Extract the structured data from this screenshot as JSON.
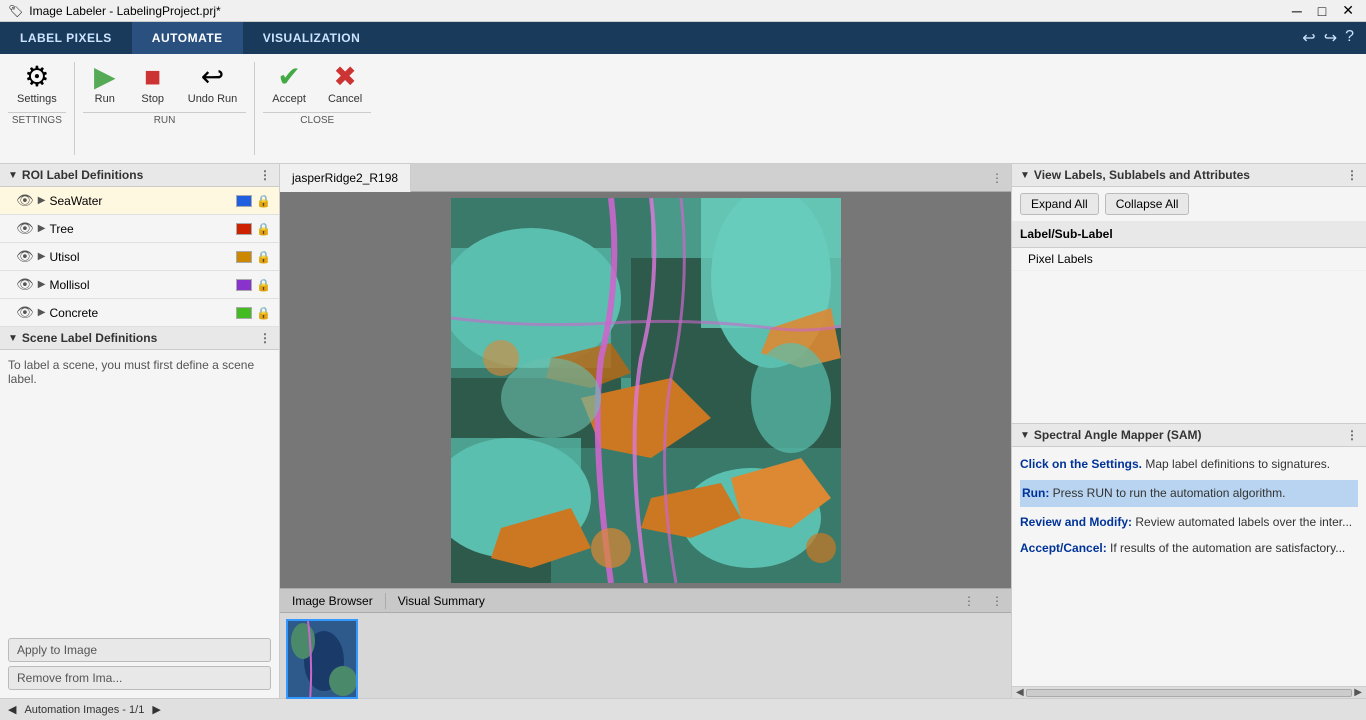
{
  "window": {
    "title": "Image Labeler - LabelingProject.prj*",
    "icon": "🏷"
  },
  "tabs": {
    "items": [
      {
        "label": "LABEL PIXELS",
        "active": false
      },
      {
        "label": "AUTOMATE",
        "active": true
      },
      {
        "label": "VISUALIZATION",
        "active": false
      }
    ]
  },
  "toolbar": {
    "settings_label": "Settings",
    "run_label": "Run",
    "stop_label": "Stop",
    "undo_run_label": "Undo Run",
    "accept_label": "Accept",
    "cancel_label": "Cancel",
    "groups": {
      "settings": "SETTINGS",
      "run": "RUN",
      "close": "CLOSE"
    }
  },
  "left_panel": {
    "roi_header": "ROI Label Definitions",
    "roi_items": [
      {
        "label": "SeaWater",
        "color": "#2060e0",
        "selected": true
      },
      {
        "label": "Tree",
        "color": "#cc2200"
      },
      {
        "label": "Utisol",
        "color": "#cc8800"
      },
      {
        "label": "Mollisol",
        "color": "#8833cc"
      },
      {
        "label": "Concrete",
        "color": "#44bb22"
      }
    ],
    "scene_header": "Scene Label Definitions",
    "scene_description": "To label a scene, you must first define a scene label.",
    "apply_btn": "Apply to Image",
    "remove_btn": "Remove from Ima..."
  },
  "image_tab": {
    "title": "jasperRidge2_R198",
    "menu_icon": "⋮"
  },
  "right_panel": {
    "labels_header": "View Labels, Sublabels and Attributes",
    "expand_all": "Expand All",
    "collapse_all": "Collapse All",
    "table_col": "Label/Sub-Label",
    "table_row": "Pixel Labels",
    "sam_header": "Spectral Angle Mapper (SAM)",
    "sam_steps": [
      {
        "label": "Click on the Settings.",
        "text": " Map label definitions to signatures."
      },
      {
        "label": "Run:",
        "text": " Press RUN to run the automation algorithm."
      },
      {
        "label": "Review and Modify:",
        "text": " Review automated labels over the inter..."
      },
      {
        "label": "Accept/Cancel:",
        "text": " If results of the automation are satisfactory..."
      }
    ]
  },
  "bottom_panel": {
    "browser_label": "Image Browser",
    "summary_label": "Visual Summary",
    "status": "Automation Images - 1/1"
  },
  "colors": {
    "accent_blue": "#1a3a5c",
    "tab_active": "#2a5080",
    "seawater_color": "#2060e0",
    "tree_color": "#cc2200",
    "utisol_color": "#cc8800",
    "mollisol_color": "#8833cc",
    "concrete_color": "#44bb22",
    "highlight": "#b8d4f0"
  }
}
